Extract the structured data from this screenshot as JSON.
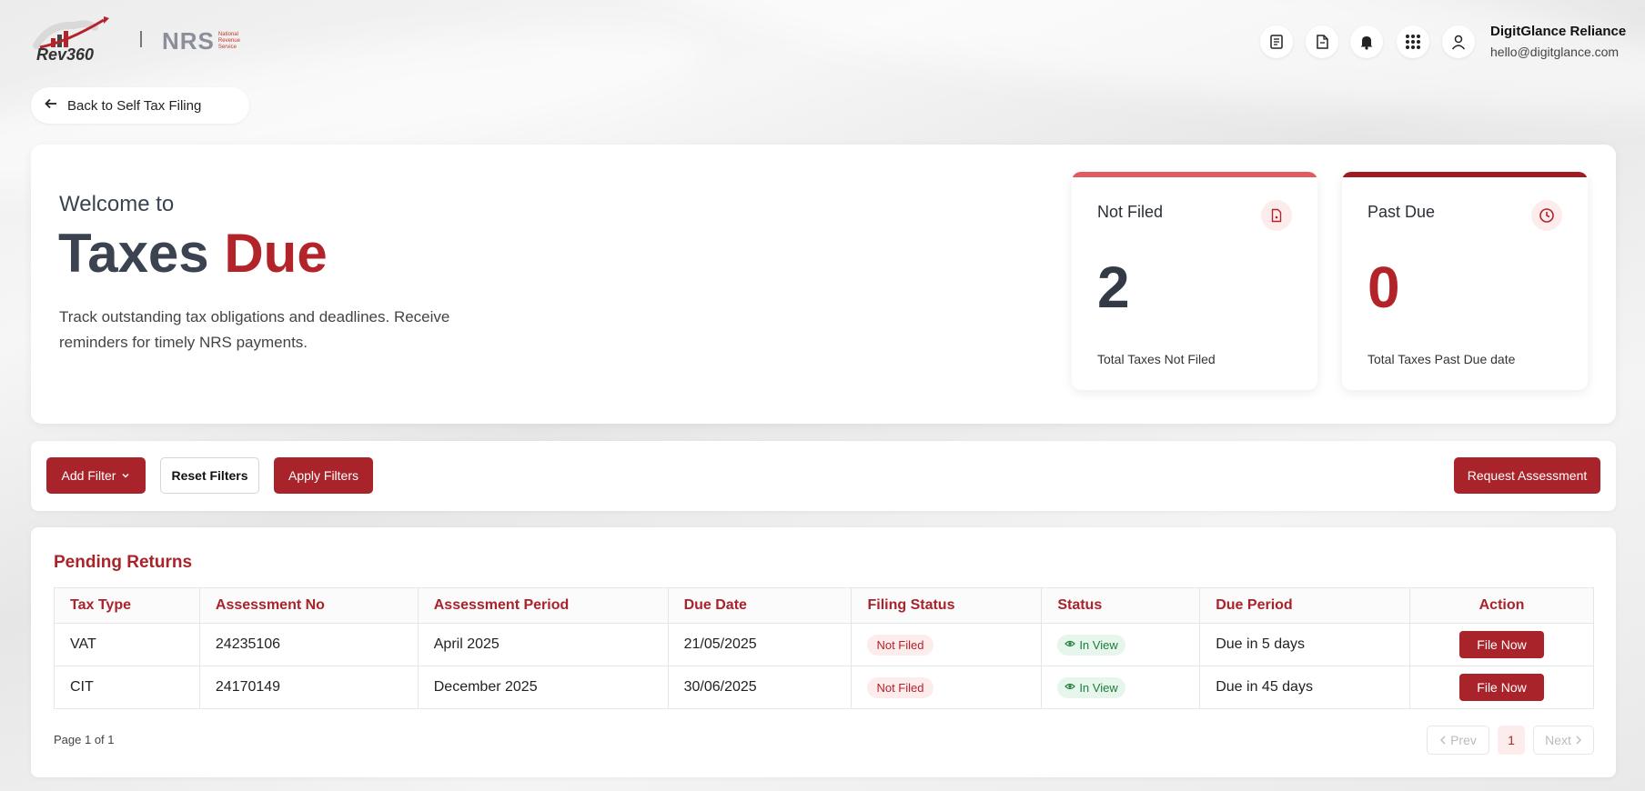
{
  "header": {
    "brand_logo_text": "Rev360",
    "partner_logo_text": "NRS",
    "partner_logo_subtitle": [
      "National",
      "Revenue",
      "Service"
    ],
    "icons": [
      "document-list-icon",
      "file-icon",
      "bell-icon",
      "apps-grid-icon",
      "user-icon"
    ],
    "user_name": "DigitGlance Reliance",
    "user_email": "hello@digitglance.com"
  },
  "back_button": {
    "label": "Back to Self Tax Filing"
  },
  "hero": {
    "welcome": "Welcome to",
    "title_main": "Taxes ",
    "title_accent": "Due",
    "description": "Track outstanding tax obligations and deadlines. Receive reminders for timely NRS payments."
  },
  "stats": [
    {
      "title": "Not Filed",
      "value": "2",
      "label": "Total Taxes Not Filed",
      "icon": "file-icon",
      "value_color": "#333a45",
      "bar_color": "#e05a5f"
    },
    {
      "title": "Past Due",
      "value": "0",
      "label": "Total Taxes Past Due date",
      "icon": "clock-icon",
      "value_color": "#b3232a",
      "bar_color": "#9e1b22"
    }
  ],
  "filters": {
    "add_filter": "Add Filter",
    "reset_filters": "Reset Filters",
    "apply_filters": "Apply Filters",
    "request_assessment": "Request Assessment"
  },
  "table": {
    "title": "Pending Returns",
    "columns": [
      "Tax Type",
      "Assessment No",
      "Assessment Period",
      "Due Date",
      "Filing Status",
      "Status",
      "Due Period",
      "Action"
    ],
    "rows": [
      {
        "tax_type": "VAT",
        "assessment_no": "24235106",
        "period": "April 2025",
        "due_date": "21/05/2025",
        "filing_status": "Not Filed",
        "status": "In View",
        "due_period": "Due in 5 days",
        "action": "File Now"
      },
      {
        "tax_type": "CIT",
        "assessment_no": "24170149",
        "period": "December 2025",
        "due_date": "30/06/2025",
        "filing_status": "Not Filed",
        "status": "In View",
        "due_period": "Due in 45 days",
        "action": "File Now"
      }
    ]
  },
  "pagination": {
    "info": "Page 1 of 1",
    "prev": "Prev",
    "current": "1",
    "next": "Next"
  },
  "colors": {
    "brand_red": "#a8232a",
    "accent_red": "#b3232a",
    "success_green": "#1e7d3a"
  }
}
